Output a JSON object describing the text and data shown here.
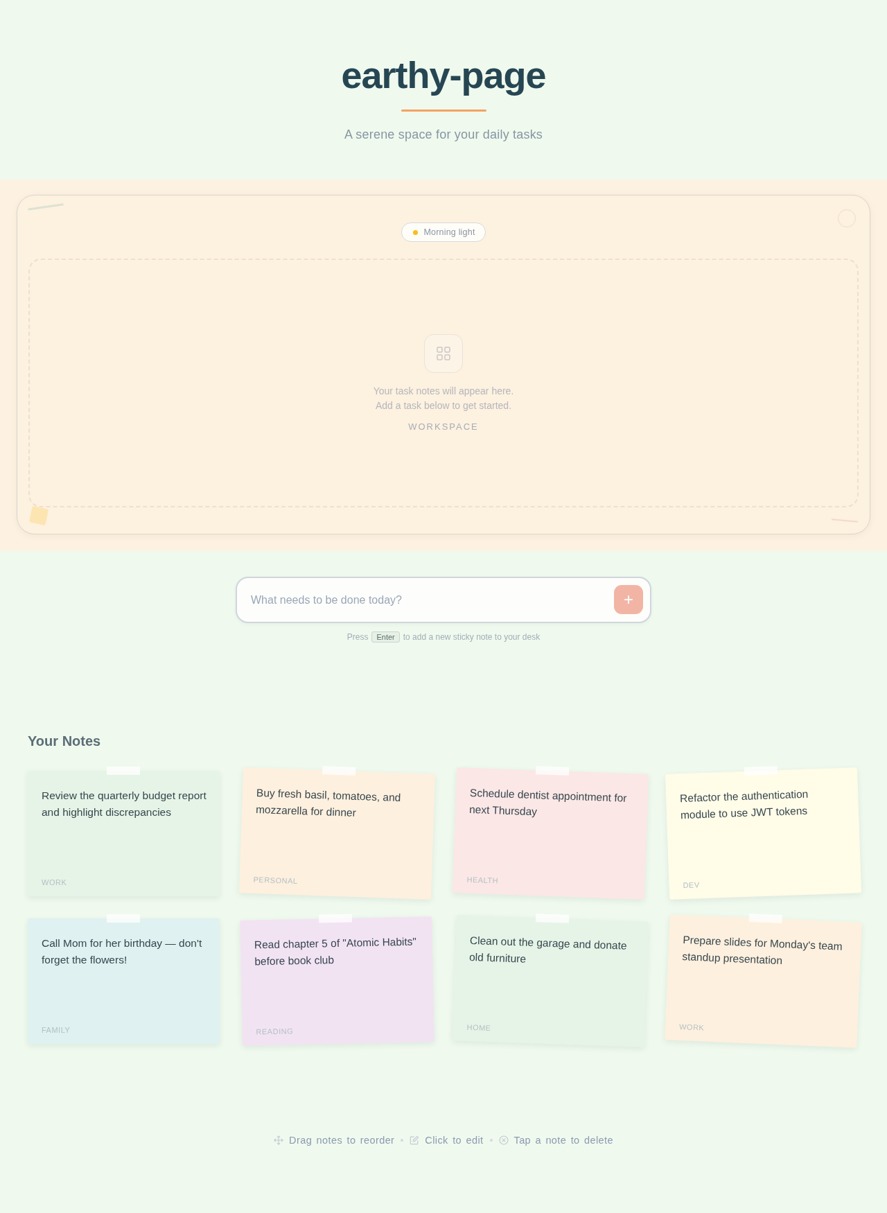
{
  "header": {
    "title": "earthy-page",
    "subtitle": "A serene space for your daily tasks"
  },
  "workspace": {
    "badge": "Morning light",
    "empty_state": {
      "lines": [
        "Your task notes will appear here.",
        "Add a task below to get started."
      ],
      "caption": "WORKSPACE"
    }
  },
  "composer": {
    "placeholder": "What needs to be done today?",
    "add_button": "+",
    "hint": {
      "before": "Press",
      "key": "Enter",
      "after": "to add a new sticky note to your desk"
    }
  },
  "notes": {
    "heading": "Your Notes",
    "items": [
      {
        "text": "Review the quarterly budget report and highlight discrepancies",
        "category": "WORK",
        "color": "#e6f4e7"
      },
      {
        "text": "Buy fresh basil, tomatoes, and mozzarella for dinner",
        "category": "PERSONAL",
        "color": "#fef0de"
      },
      {
        "text": "Schedule dentist appointment for next Thursday",
        "category": "HEALTH",
        "color": "#fbe7e6"
      },
      {
        "text": "Refactor the authentication module to use JWT tokens",
        "category": "DEV",
        "color": "#fffce8"
      },
      {
        "text": "Call Mom for her birthday — don't forget the flowers!",
        "category": "FAMILY",
        "color": "#dff1f0"
      },
      {
        "text": "Read chapter 5 of \"Atomic Habits\" before book club",
        "category": "READING",
        "color": "#f2e3f3"
      },
      {
        "text": "Clean out the garage and donate old furniture",
        "category": "HOME",
        "color": "#e6f4e7"
      },
      {
        "text": "Prepare slides for Monday's team standup presentation",
        "category": "WORK",
        "color": "#fef0de"
      }
    ]
  },
  "footer": {
    "tips": [
      {
        "kind": "move",
        "text": "Drag notes to reorder"
      },
      {
        "kind": "edit",
        "text": "Click to edit"
      },
      {
        "kind": "delete",
        "text": "Tap a note to delete"
      }
    ]
  }
}
